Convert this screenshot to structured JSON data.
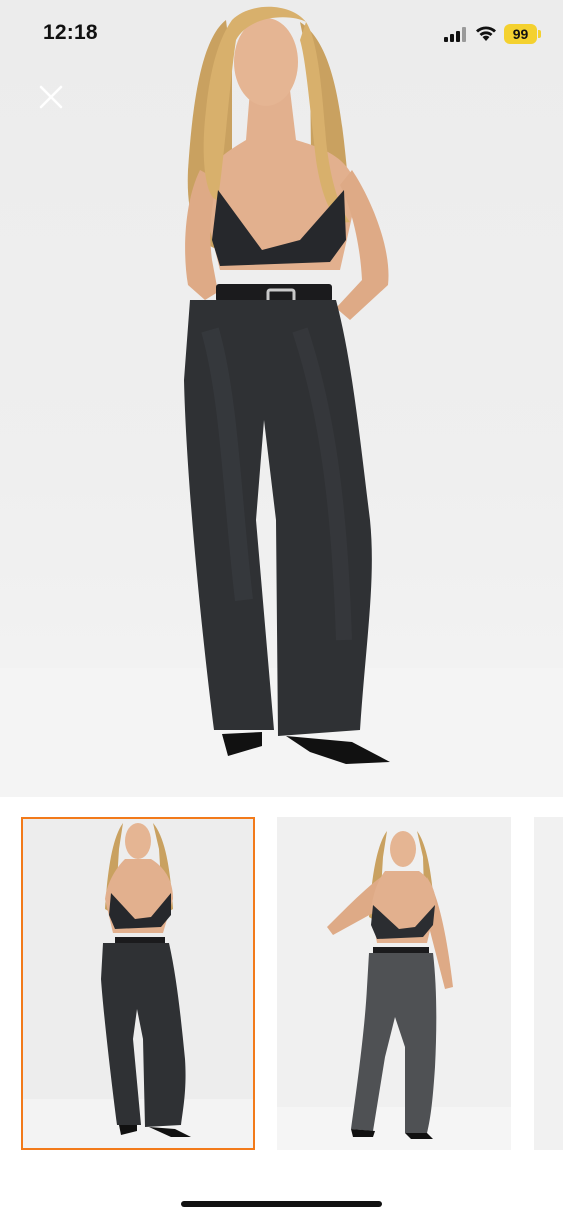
{
  "status_bar": {
    "time": "12:18",
    "battery": "99",
    "battery_color": "#f4d12f"
  },
  "viewer": {
    "close_icon": "close-icon",
    "selected_thumbnail": 1,
    "accent_color": "#f27a1a"
  },
  "thumbnails": [
    {
      "name": "product-photo-black-jeans-front"
    },
    {
      "name": "product-photo-grey-jeans-angle"
    },
    {
      "name": "product-photo-partial"
    }
  ]
}
